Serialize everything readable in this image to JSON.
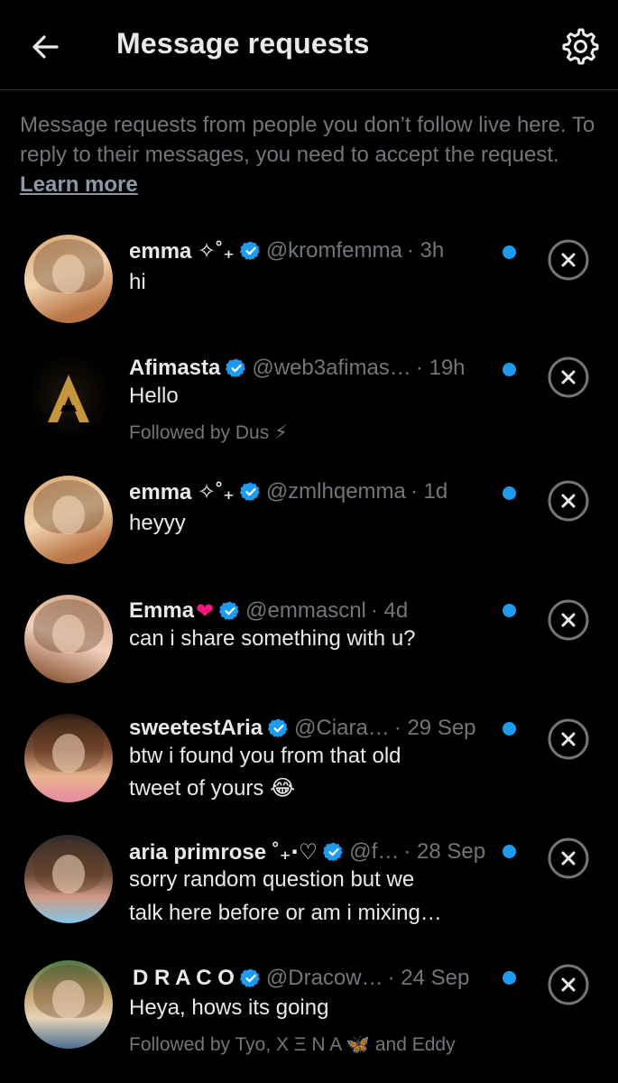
{
  "header": {
    "title": "Message requests",
    "back_icon": "back-arrow-icon",
    "settings_icon": "gear-icon"
  },
  "intro": {
    "text": "Message requests from people you don’t follow live here. To reply to their messages, you need to accept the request. ",
    "link": "Learn more"
  },
  "colors": {
    "accent": "#1d9bf0",
    "muted": "#71767b",
    "text": "#e7e9ea",
    "background": "#000000"
  },
  "requests": [
    {
      "name": "emma ✧˚₊",
      "handle": "@kromfemma",
      "time": "· 3h",
      "message": "hi",
      "followed": ""
    },
    {
      "name": "Afimasta",
      "handle": "@web3afimas…",
      "time": "· 19h",
      "message": "Hello",
      "followed": "Followed by Dus ⚡"
    },
    {
      "name": "emma ✧˚₊",
      "handle": "@zmlhqemma",
      "time": "· 1d",
      "message": "heyyy",
      "followed": ""
    },
    {
      "name": "Emma",
      "handle": "@emmascnl",
      "time": "· 4d",
      "message": "can i share something with u?",
      "followed": ""
    },
    {
      "name": "sweetestAria",
      "handle": "@Ciara…",
      "time": "· 29 Sep",
      "message": "btw i found you from that old",
      "message2": "tweet of yours 😂",
      "followed": ""
    },
    {
      "name": "aria primrose ˚₊‧♡",
      "handle": "@f…",
      "time": "· 28 Sep",
      "message": "sorry random question but we",
      "message2": "talk here before or am i mixing…",
      "followed": ""
    },
    {
      "name": "D R A C O",
      "handle": "@Dracow…",
      "time": "· 24 Sep",
      "message": "Heya, hows its going",
      "followed": "Followed by Tyo, X Ξ N A 🦋 and Eddy"
    }
  ]
}
